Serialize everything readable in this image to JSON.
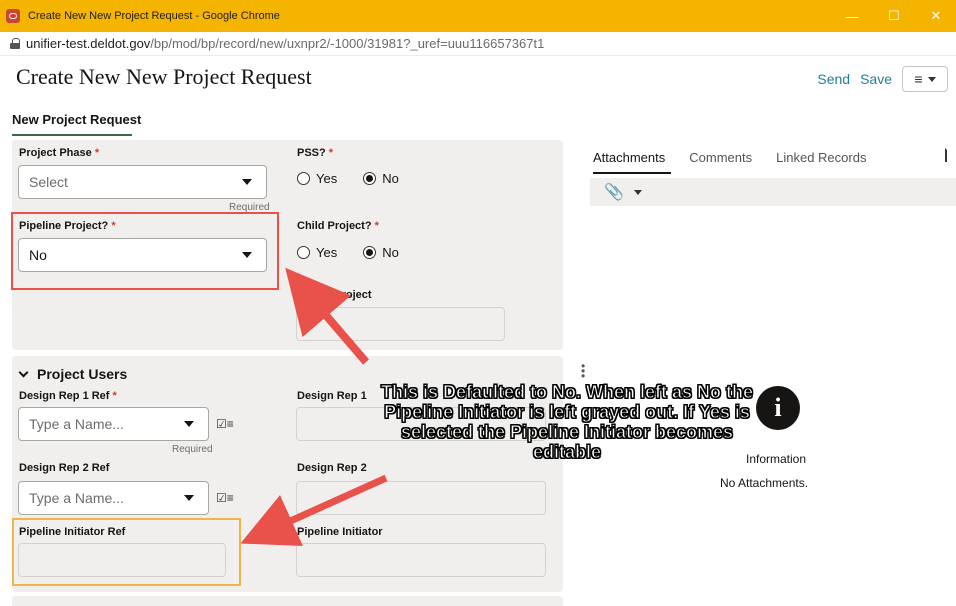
{
  "window": {
    "title": "Create New New Project Request - Google Chrome",
    "minimize_icon": "minimize-icon",
    "maximize_icon": "maximize-icon",
    "close_icon": "close-icon"
  },
  "address_bar": {
    "domain": "unifier-test.deldot.gov",
    "path": "/bp/mod/bp/record/new/uxnpr2/-1000/31981?_uref=uuu116657367t1"
  },
  "header": {
    "title": "Create New New Project Request",
    "send_label": "Send",
    "save_label": "Save",
    "menu_icon": "hamburger-icon"
  },
  "tabs": [
    {
      "label": "New Project Request",
      "active": true
    }
  ],
  "form": {
    "project_phase": {
      "label": "Project Phase",
      "required_mark": "*",
      "value": "Select",
      "note": "Required"
    },
    "pss": {
      "label": "PSS?",
      "required_mark": "*",
      "options": [
        "Yes",
        "No"
      ],
      "selected": "No"
    },
    "pipeline_project": {
      "label": "Pipeline Project?",
      "required_mark": "*",
      "value": "No"
    },
    "child_project": {
      "label": "Child Project?",
      "required_mark": "*",
      "options": [
        "Yes",
        "No"
      ],
      "selected": "No"
    },
    "parent_project": {
      "label": "Parent Project"
    },
    "users_section": {
      "title": "Project Users",
      "design_rep_1_ref": {
        "label": "Design Rep 1 Ref",
        "required_mark": "*",
        "placeholder": "Type a Name...",
        "note": "Required"
      },
      "design_rep_1": {
        "label": "Design Rep 1"
      },
      "design_rep_2_ref": {
        "label": "Design Rep 2 Ref",
        "placeholder": "Type a Name..."
      },
      "design_rep_2": {
        "label": "Design Rep 2"
      },
      "pipeline_initiator_ref": {
        "label": "Pipeline Initiator Ref"
      },
      "pipeline_initiator": {
        "label": "Pipeline Initiator"
      }
    }
  },
  "right_panel": {
    "tabs": [
      "Attachments",
      "Comments",
      "Linked Records"
    ],
    "active_tab": "Attachments",
    "info_label": "Information",
    "empty_text": "No Attachments."
  },
  "annotation": {
    "callout_text": "This is Defaulted to No.  When left as No the Pipeline Initiator is left grayed out.  If Yes is selected the Pipeline Initiator becomes editable",
    "arrow_color": "#e8524a",
    "box_red": "#e8524a",
    "box_orange": "#f0b54a"
  },
  "colors": {
    "titlebar": "#f4b400",
    "link": "#227e9e",
    "required": "#d63b25",
    "panel": "#f1efed"
  }
}
